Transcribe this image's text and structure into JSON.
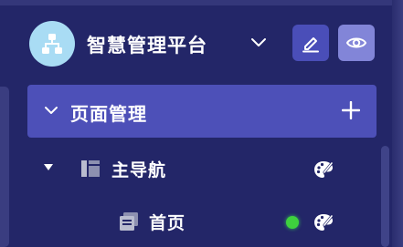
{
  "header": {
    "title": "智慧管理平台",
    "avatar_icon": "sitemap-icon",
    "dropdown_icon": "chevron-down-icon",
    "edit_icon": "pencil-icon",
    "view_icon": "eye-icon"
  },
  "section": {
    "title": "页面管理",
    "collapse_icon": "chevron-down-icon",
    "add_icon": "plus-icon"
  },
  "tree": [
    {
      "label": "主导航",
      "type": "group",
      "expanded": true,
      "icon": "sidebar-layout-icon",
      "action_icon": "palette-icon"
    },
    {
      "label": "首页",
      "type": "page",
      "status": "active",
      "icon": "pages-icon",
      "action_icon": "palette-icon"
    }
  ],
  "colors": {
    "background": "#232668",
    "section_bg": "#4d50b8",
    "edit_button": "#4a4eb8",
    "view_button": "#8285d8",
    "avatar": "#a9dcf4",
    "status_active": "#3ed13e"
  }
}
